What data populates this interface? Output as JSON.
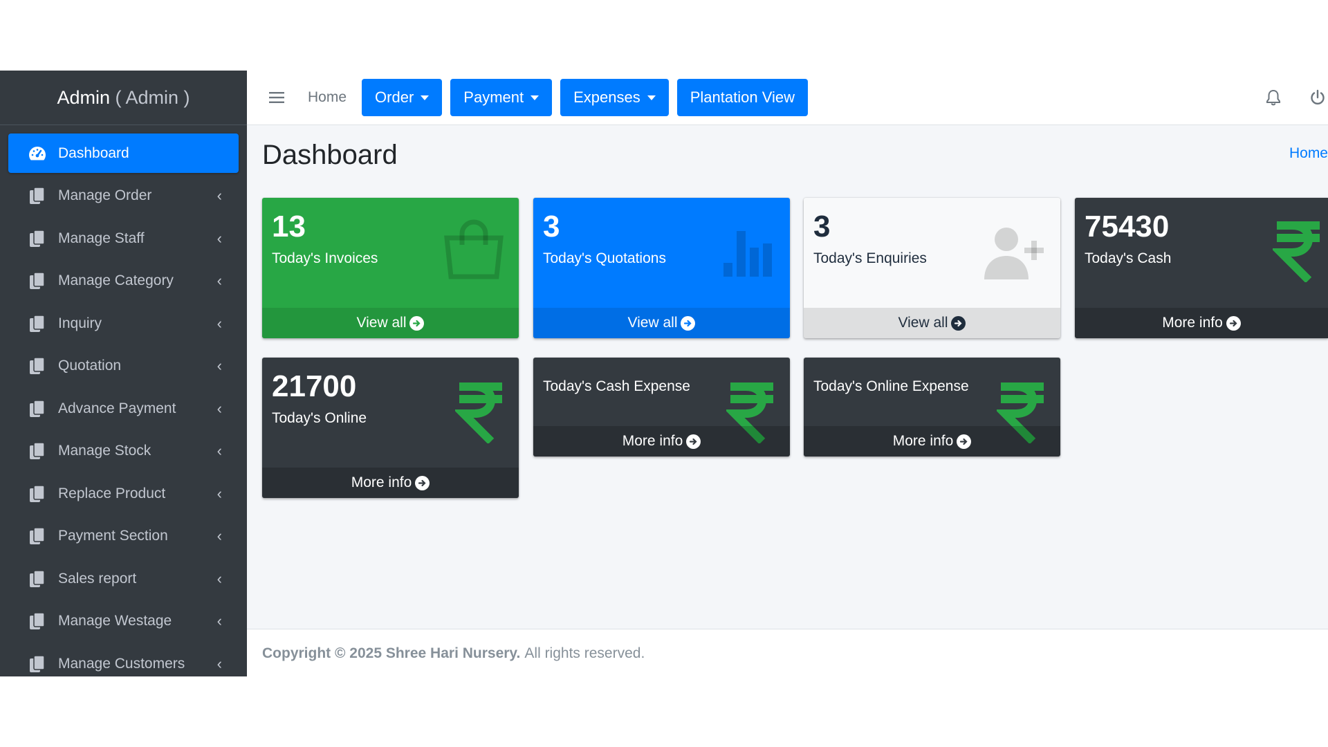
{
  "brand": {
    "name": "Admin",
    "role": "( Admin )"
  },
  "sidebar": {
    "items": [
      {
        "label": "Dashboard",
        "icon": "tachometer-icon",
        "active": true
      },
      {
        "label": "Manage Order",
        "icon": "copy-icon"
      },
      {
        "label": "Manage Staff",
        "icon": "copy-icon"
      },
      {
        "label": "Manage Category",
        "icon": "copy-icon"
      },
      {
        "label": "Inquiry",
        "icon": "copy-icon"
      },
      {
        "label": "Quotation",
        "icon": "copy-icon"
      },
      {
        "label": "Advance Payment",
        "icon": "copy-icon"
      },
      {
        "label": "Manage Stock",
        "icon": "copy-icon"
      },
      {
        "label": "Replace Product",
        "icon": "copy-icon"
      },
      {
        "label": "Payment Section",
        "icon": "copy-icon"
      },
      {
        "label": "Sales report",
        "icon": "copy-icon"
      },
      {
        "label": "Manage Westage",
        "icon": "copy-icon"
      },
      {
        "label": "Manage Customers",
        "icon": "copy-icon"
      }
    ]
  },
  "topbar": {
    "home": "Home",
    "buttons": [
      {
        "label": "Order",
        "dropdown": true
      },
      {
        "label": "Payment",
        "dropdown": true
      },
      {
        "label": "Expenses",
        "dropdown": true
      },
      {
        "label": "Plantation View",
        "dropdown": false
      }
    ],
    "icons": [
      "bell-icon",
      "power-icon"
    ]
  },
  "page": {
    "title": "Dashboard",
    "breadcrumb": "Home"
  },
  "cards": [
    {
      "value": "13",
      "label": "Today's Invoices",
      "link": "View all",
      "theme": "green",
      "icon": "shopping-bag-icon"
    },
    {
      "value": "3",
      "label": "Today's Quotations",
      "link": "View all",
      "theme": "blue",
      "icon": "bar-chart-icon"
    },
    {
      "value": "3",
      "label": "Today's Enquiries",
      "link": "View all",
      "theme": "light",
      "icon": "user-plus-icon"
    },
    {
      "value": "75430",
      "label": "Today's Cash",
      "link": "More info",
      "theme": "dark",
      "icon": "rupee-icon"
    },
    {
      "value": "21700",
      "label": "Today's Online",
      "link": "More info",
      "theme": "dark",
      "icon": "rupee-icon"
    },
    {
      "value": "",
      "label": "Today's Cash Expense",
      "link": "More info",
      "theme": "dark",
      "icon": "rupee-icon"
    },
    {
      "value": "",
      "label": "Today's Online Expense",
      "link": "More info",
      "theme": "dark",
      "icon": "rupee-icon"
    }
  ],
  "footer": {
    "copyright": "Copyright © 2025 Shree Hari Nursery.",
    "rights": "All rights reserved."
  },
  "colors": {
    "primary": "#007bff",
    "success": "#28a745",
    "sidebar": "#343a40",
    "rupee": "#28a745"
  }
}
